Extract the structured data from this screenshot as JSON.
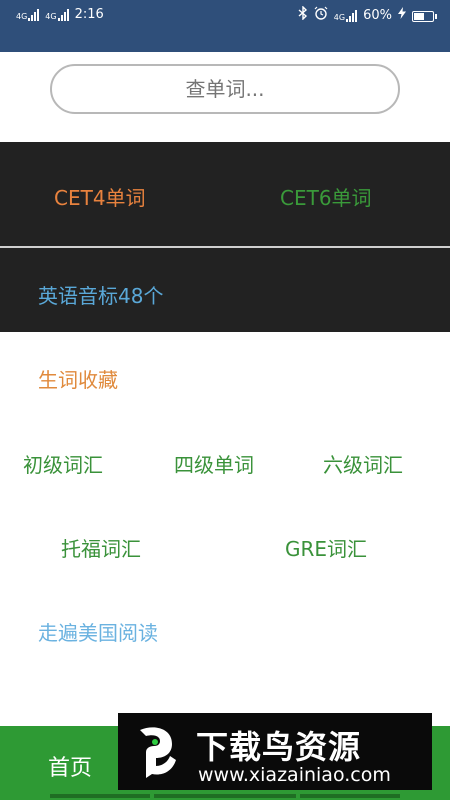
{
  "status_bar": {
    "network_left_1": "4G",
    "network_left_2": "4G",
    "time": "2:16",
    "network_right": "4G",
    "battery_percent": "60%",
    "battery_level": 0.6
  },
  "search": {
    "placeholder": "查单词..."
  },
  "categories": {
    "cet4": "CET4单词",
    "cet6": "CET6单词",
    "phonetics": "英语音标48个",
    "favorites": "生词收藏",
    "basic": "初级词汇",
    "cet4_words": "四级单词",
    "cet6_words": "六级词汇",
    "toefl": "托福词汇",
    "gre": "GRE词汇",
    "reading": "走遍美国阅读"
  },
  "bottom_nav": {
    "home": "首页"
  },
  "watermark": {
    "title": "下载鸟资源",
    "url": "www.xiazainiao.com"
  },
  "colors": {
    "status_bar": "#2f4f7a",
    "dark_row": "#222222",
    "orange": "#e8823e",
    "green": "#3a9a3a",
    "blue": "#5aa8d8",
    "bottom_bar": "#2e9a34"
  }
}
